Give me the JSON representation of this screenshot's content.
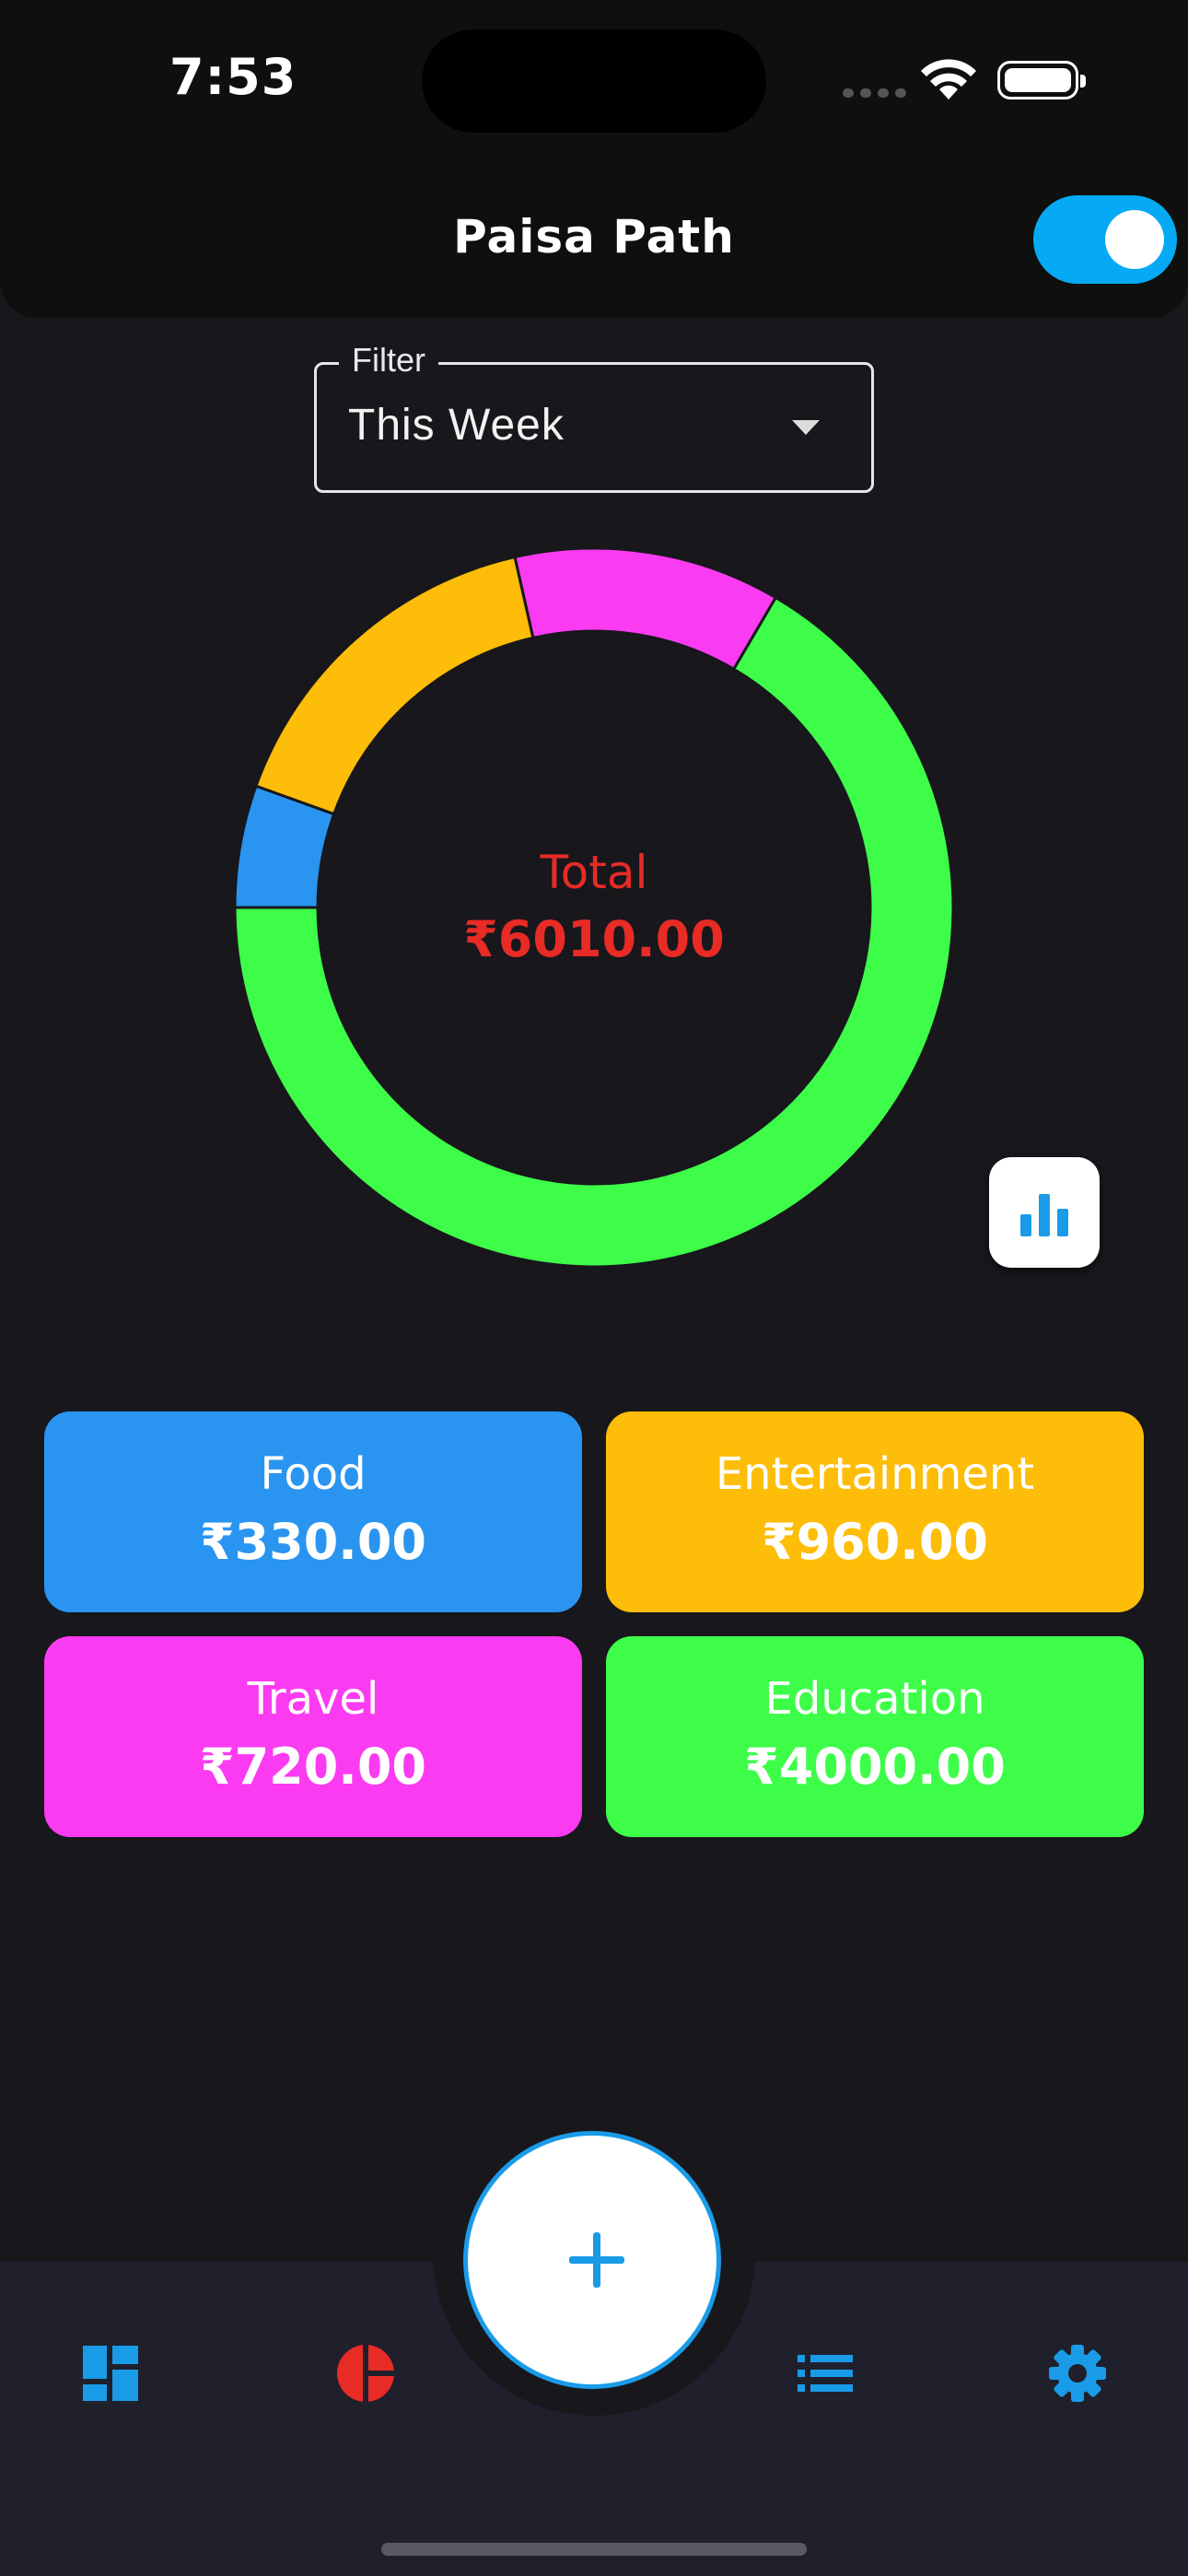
{
  "status_bar": {
    "time": "7:53"
  },
  "header": {
    "title": "Paisa Path",
    "toggle_on": true
  },
  "filter": {
    "label": "Filter",
    "value": "This Week"
  },
  "summary": {
    "total_label": "Total",
    "total_value": "₹6010.00"
  },
  "chart_data": {
    "type": "pie",
    "style": "donut",
    "slices": [
      {
        "name": "Food",
        "value": 330,
        "color": "#2a95f0"
      },
      {
        "name": "Entertainment",
        "value": 960,
        "color": "#fdbd08"
      },
      {
        "name": "Travel",
        "value": 720,
        "color": "#fb3bf1"
      },
      {
        "name": "Education",
        "value": 4000,
        "color": "#3dfd49"
      }
    ]
  },
  "categories": [
    {
      "name": "Food",
      "amount": "₹330.00",
      "color": "#2a95f0"
    },
    {
      "name": "Entertainment",
      "amount": "₹960.00",
      "color": "#fdbd08"
    },
    {
      "name": "Travel",
      "amount": "₹720.00",
      "color": "#fb3bf1"
    },
    {
      "name": "Education",
      "amount": "₹4000.00",
      "color": "#3dfd49"
    }
  ],
  "nav": {
    "items": [
      {
        "icon": "dashboard-icon",
        "color": "#1a9be8"
      },
      {
        "icon": "pie-chart-icon",
        "color": "#e82b25"
      },
      {
        "icon": "add-icon",
        "color": "#1a9be8"
      },
      {
        "icon": "list-icon",
        "color": "#1a9be8"
      },
      {
        "icon": "settings-icon",
        "color": "#1a9be8"
      }
    ]
  }
}
